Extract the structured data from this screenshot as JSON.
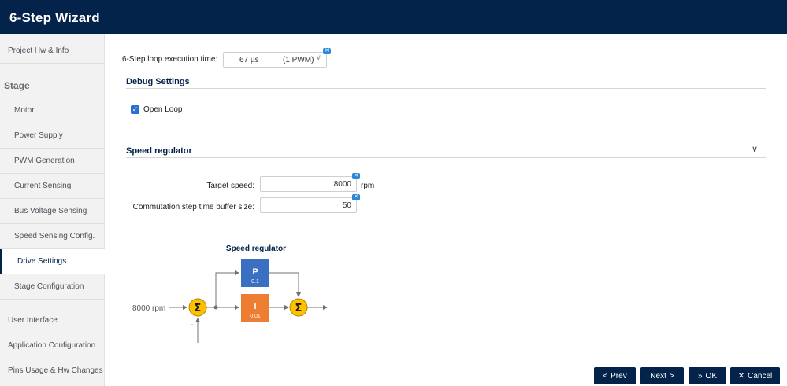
{
  "app": {
    "title": "6-Step Wizard"
  },
  "sidebar": {
    "items": [
      {
        "label": "Project Hw & Info"
      },
      {
        "label": "Stage"
      },
      {
        "label": "Motor"
      },
      {
        "label": "Power Supply"
      },
      {
        "label": "PWM Generation"
      },
      {
        "label": "Current Sensing"
      },
      {
        "label": "Bus Voltage Sensing"
      },
      {
        "label": "Speed Sensing Config."
      },
      {
        "label": "Drive Settings",
        "active": true
      },
      {
        "label": "Stage Configuration"
      },
      {
        "label": "User Interface"
      },
      {
        "label": "Application Configuration"
      },
      {
        "label": "Pins Usage & Hw Changes"
      }
    ]
  },
  "loop": {
    "label": "6-Step loop execution time:",
    "value": "67 µs",
    "unit": "(1 PWM)"
  },
  "debug": {
    "title": "Debug Settings",
    "open_loop_label": "Open Loop",
    "open_loop_checked": true
  },
  "speed": {
    "title": "Speed regulator",
    "target_label": "Target speed:",
    "target_value": "8000",
    "target_unit": "rpm",
    "buffer_label": "Commutation step time buffer size:",
    "buffer_value": "50"
  },
  "diagram": {
    "title": "Speed regulator",
    "input": "8000 rpm",
    "sum_symbol": "Σ",
    "minus": "-",
    "p_label": "P",
    "p_value": "0.1",
    "i_label": "I",
    "i_value": "0.01"
  },
  "footer": {
    "prev": "Prev",
    "next": "Next",
    "ok": "OK",
    "cancel": "Cancel"
  },
  "colors": {
    "header": "#03234b",
    "p_block": "#3a6fc2",
    "i_block": "#ed7d31",
    "sum_node": "#ffc000",
    "reset_badge": "#2b88d8"
  }
}
